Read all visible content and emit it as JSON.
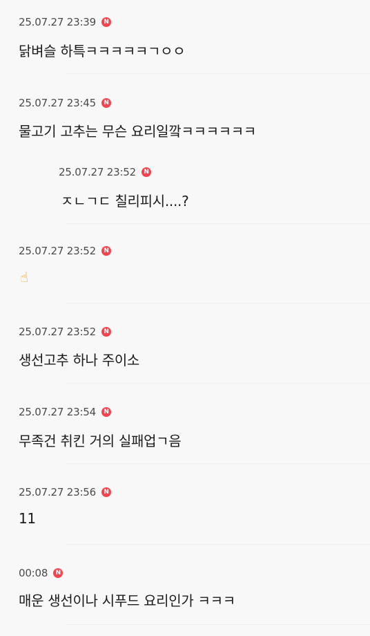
{
  "comments": [
    {
      "time": "25.07.27 23:39",
      "badge": "N",
      "text": "닭벼슬 하특ㅋㅋㅋㅋㅋㄱㅇㅇ",
      "reply": false
    },
    {
      "time": "25.07.27 23:45",
      "badge": "N",
      "text": "물고기 고추는 무슨 요리일깤ㅋㅋㅋㅋㅋㅋ",
      "reply": false
    },
    {
      "time": "25.07.27 23:52",
      "badge": "N",
      "text": "ㅈㄴㄱㄷ 칠리피시....?",
      "reply": true
    },
    {
      "time": "25.07.27 23:52",
      "badge": "N",
      "text": "☝",
      "reply": false
    },
    {
      "time": "25.07.27 23:52",
      "badge": "N",
      "text": "생선고추 하나 주이소",
      "reply": false
    },
    {
      "time": "25.07.27 23:54",
      "badge": "N",
      "text": "무족건 취킨 거의 실패업ㄱ음",
      "reply": false
    },
    {
      "time": "25.07.27 23:56",
      "badge": "N",
      "text": "11",
      "reply": false
    },
    {
      "time": "00:08",
      "badge": "N",
      "text": "매운 생선이나 시푸드 요리인가 ㅋㅋㅋ",
      "reply": false
    }
  ]
}
